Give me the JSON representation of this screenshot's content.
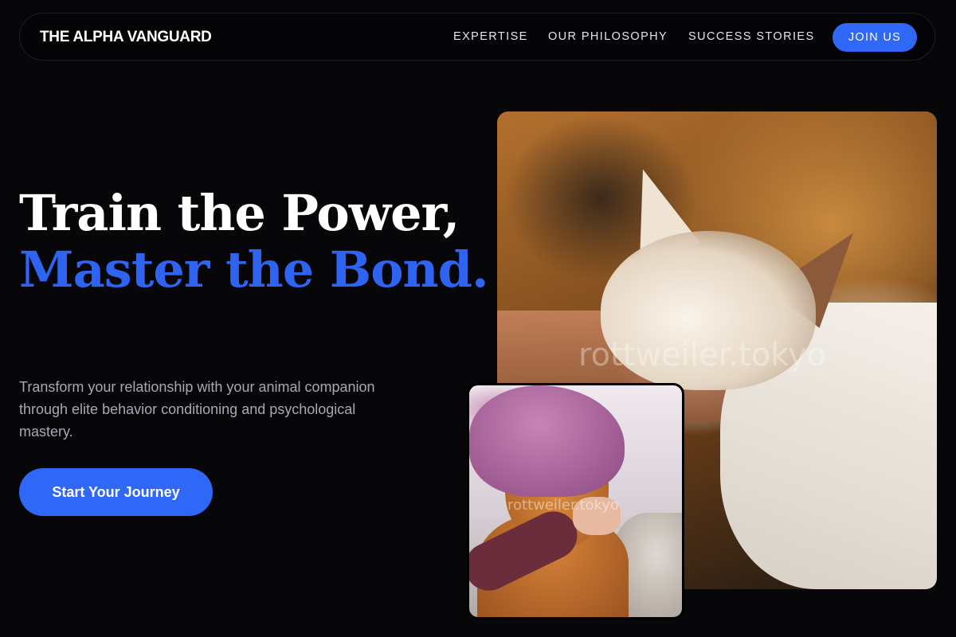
{
  "nav": {
    "brand": "THE ALPHA VANGUARD",
    "links": [
      "EXPERTISE",
      "OUR PHILOSOPHY",
      "SUCCESS STORIES"
    ],
    "cta": "JOIN US"
  },
  "hero": {
    "title_line1": "Train the Power,",
    "title_line2": "Master the Bond.",
    "description": "Transform your relationship with your animal companion through elite behavior conditioning and psychological mastery.",
    "cta": "Start Your Journey"
  },
  "images": {
    "main_watermark": "rottweiler.tokyo",
    "secondary_watermark": "rottweiler.tokyo"
  },
  "colors": {
    "accent": "#2f67f6",
    "background": "#07070a",
    "text_muted": "#a6a8b4"
  }
}
